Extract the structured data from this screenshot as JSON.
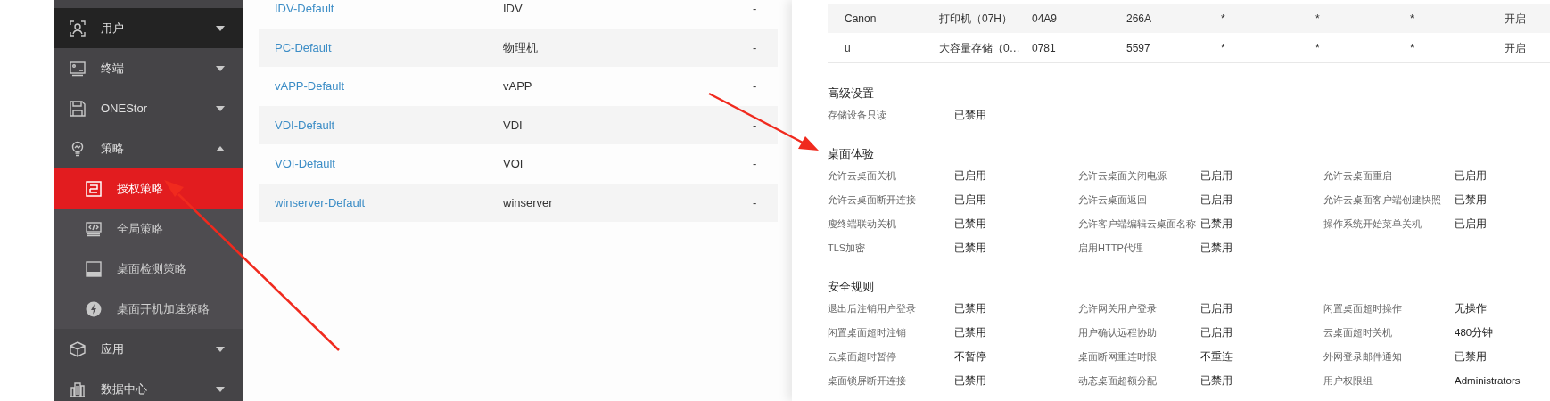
{
  "sidebar": {
    "items": [
      {
        "label": "用户",
        "kind": "user",
        "expanded": false,
        "hovered": true
      },
      {
        "label": "终端",
        "kind": "terminal",
        "expanded": false,
        "hovered": false
      },
      {
        "label": "ONEStor",
        "kind": "storage",
        "expanded": false,
        "hovered": false
      },
      {
        "label": "策略",
        "kind": "bulb",
        "expanded": true,
        "hovered": false,
        "children": [
          {
            "label": "授权策略",
            "kind": "license",
            "selected": true
          },
          {
            "label": "全局策略",
            "kind": "code",
            "selected": false
          },
          {
            "label": "桌面检测策略",
            "kind": "monitor",
            "selected": false
          },
          {
            "label": "桌面开机加速策略",
            "kind": "bolt",
            "selected": false
          }
        ]
      },
      {
        "label": "应用",
        "kind": "cube",
        "expanded": false,
        "hovered": false
      },
      {
        "label": "数据中心",
        "kind": "building",
        "expanded": false,
        "hovered": false
      }
    ]
  },
  "policy_table": {
    "rows": [
      {
        "name": "IDV-Default",
        "type": "IDV",
        "column_3": "-"
      },
      {
        "name": "PC-Default",
        "type": "物理机",
        "column_3": "-"
      },
      {
        "name": "vAPP-Default",
        "type": "vAPP",
        "column_3": "-"
      },
      {
        "name": "VDI-Default",
        "type": "VDI",
        "column_3": "-"
      },
      {
        "name": "VOI-Default",
        "type": "VOI",
        "column_3": "-"
      },
      {
        "name": "winserver-Default",
        "type": "winserver",
        "column_3": "-"
      }
    ]
  },
  "usb_devices": {
    "rows": [
      [
        "Canon",
        "打印机（07H）",
        "04A9",
        "266A",
        "*",
        "*",
        "*",
        "开启"
      ],
      [
        "u",
        "大容量存储（0…",
        "0781",
        "5597",
        "*",
        "*",
        "*",
        "开启"
      ]
    ]
  },
  "sections": [
    {
      "title": "高级设置",
      "items": [
        {
          "label": "存储设备只读",
          "value": "已禁用"
        }
      ]
    },
    {
      "title": "桌面体验",
      "items": [
        {
          "label": "允许云桌面关机",
          "value": "已启用"
        },
        {
          "label": "允许云桌面关闭电源",
          "value": "已启用"
        },
        {
          "label": "允许云桌面重启",
          "value": "已启用"
        },
        {
          "label": "允许云桌面断开连接",
          "value": "已启用"
        },
        {
          "label": "允许云桌面返回",
          "value": "已启用"
        },
        {
          "label": "允许云桌面客户端创建快照",
          "value": "已禁用"
        },
        {
          "label": "瘦终端联动关机",
          "value": "已禁用"
        },
        {
          "label": "允许客户端编辑云桌面名称",
          "value": "已禁用"
        },
        {
          "label": "操作系统开始菜单关机",
          "value": "已启用"
        },
        {
          "label": "TLS加密",
          "value": "已禁用"
        },
        {
          "label": "启用HTTP代理",
          "value": "已禁用"
        }
      ]
    },
    {
      "title": "安全规则",
      "items": [
        {
          "label": "退出后注销用户登录",
          "value": "已禁用"
        },
        {
          "label": "允许网关用户登录",
          "value": "已启用"
        },
        {
          "label": "闲置桌面超时操作",
          "value": "无操作"
        },
        {
          "label": "闲置桌面超时注销",
          "value": "已禁用"
        },
        {
          "label": "用户确认远程协助",
          "value": "已启用"
        },
        {
          "label": "云桌面超时关机",
          "value": "480分钟"
        },
        {
          "label": "云桌面超时暂停",
          "value": "不暂停"
        },
        {
          "label": "桌面断网重连时限",
          "value": "不重连"
        },
        {
          "label": "外网登录邮件通知",
          "value": "已禁用"
        },
        {
          "label": "桌面锁屏断开连接",
          "value": "已禁用"
        },
        {
          "label": "动态桌面超额分配",
          "value": "已禁用"
        },
        {
          "label": "用户权限组",
          "value": "Administrators"
        }
      ]
    }
  ]
}
